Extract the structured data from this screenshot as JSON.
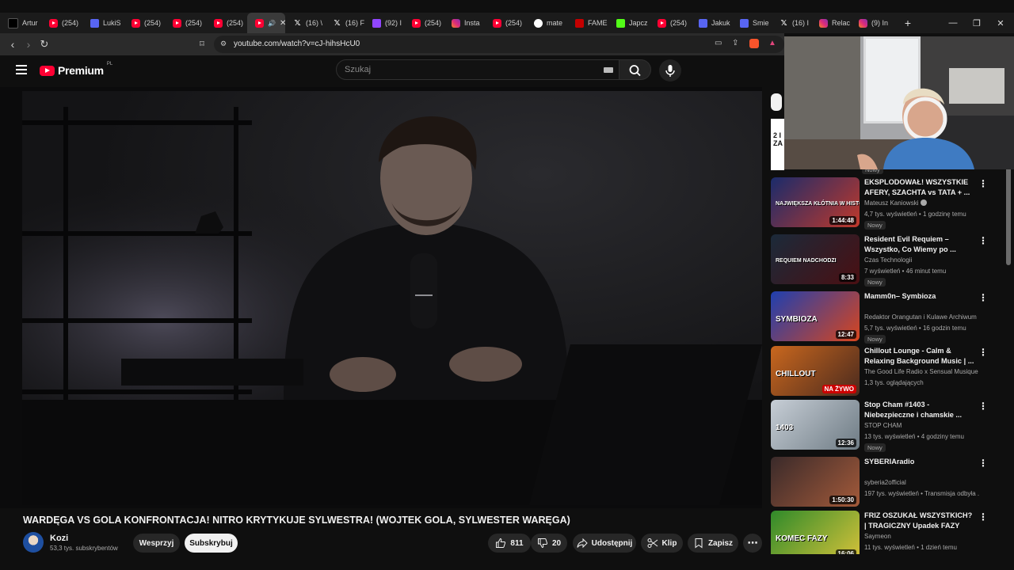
{
  "browser": {
    "tabs": [
      {
        "label": "Artur",
        "icon": "tiktok"
      },
      {
        "label": "(254)",
        "icon": "youtube"
      },
      {
        "label": "LukiS",
        "icon": "discord"
      },
      {
        "label": "(254)",
        "icon": "youtube"
      },
      {
        "label": "(254)",
        "icon": "youtube"
      },
      {
        "label": "(254)",
        "icon": "youtube"
      },
      {
        "label": "",
        "icon": "youtube-playing",
        "active": true
      },
      {
        "label": "(16) \\",
        "icon": "x"
      },
      {
        "label": "(16) F",
        "icon": "x"
      },
      {
        "label": "(92) I",
        "icon": "twitch"
      },
      {
        "label": "(254)",
        "icon": "youtube"
      },
      {
        "label": "Insta",
        "icon": "instagram"
      },
      {
        "label": "(254)",
        "icon": "youtube"
      },
      {
        "label": "mate",
        "icon": "google"
      },
      {
        "label": "FAME",
        "icon": "famemma"
      },
      {
        "label": "Japcz",
        "icon": "kick"
      },
      {
        "label": "(254)",
        "icon": "youtube"
      },
      {
        "label": "Jakuk",
        "icon": "discord"
      },
      {
        "label": "Smie",
        "icon": "discord"
      },
      {
        "label": "(16) I",
        "icon": "x"
      },
      {
        "label": "Relac",
        "icon": "instagram"
      },
      {
        "label": "(9) In",
        "icon": "instagram"
      }
    ],
    "new_tab": "+",
    "url": "youtube.com/watch?v=cJ-hihsHcU0"
  },
  "youtube": {
    "logo_text": "Premium",
    "country_code": "PL",
    "search_placeholder": "Szukaj"
  },
  "video": {
    "title": "WARDĘGA VS GOLA KONFRONTACJA! NITRO KRYTYKUJE SYLWESTRA! (WOJTEK GOLA, SYLWESTER WARĘGA)",
    "channel": "Kozi",
    "subscribers": "53,3 tys. subskrybentów",
    "join_label": "Wesprzyj",
    "subscribe_label": "Subskrybuj",
    "likes": "811",
    "dislikes": "20",
    "share_label": "Udostępnij",
    "clip_label": "Klip",
    "save_label": "Zapisz"
  },
  "sidebar": {
    "top_partial": {
      "badge": "Nowy",
      "thumb_text": "2 I ZA"
    },
    "items": [
      {
        "title": "EKSPLODOWAŁ! WSZYSTKIE AFERY, SZACHTA vs TATA + ...",
        "channel": "Mateusz Kaniowski",
        "verified": true,
        "meta": "4,7 tys. wyświetleń • 1 godzinę temu",
        "badge": "Nowy",
        "duration": "1:44:48",
        "thumb_text": "NAJWIĘKSZA KŁÓTNIA W HISTORII WWW",
        "colors": [
          "#1a2b6b",
          "#c0392b"
        ]
      },
      {
        "title": "Resident Evil Requiem – Wszystko, Co Wiemy po ...",
        "channel": "Czas Technologii",
        "verified": false,
        "meta": "7 wyświetleń • 46 minut temu",
        "badge": "Nowy",
        "duration": "8:33",
        "thumb_text": "REQUIEM NADCHODZI",
        "colors": [
          "#1b2a3a",
          "#4a0f12"
        ]
      },
      {
        "title": "Mamm0n– Symbioza",
        "channel": "Redaktor Orangutan i Kulawe Archiwum",
        "verified": false,
        "meta": "5,7 tys. wyświetleń • 16 godzin temu",
        "badge": "Nowy",
        "duration": "12:47",
        "thumb_text": "SYMBIOZA",
        "colors": [
          "#1e3fb0",
          "#d8461e"
        ]
      },
      {
        "title": "Chillout Lounge - Calm & Relaxing Background Music | ...",
        "channel": "The Good Life Radio x Sensual Musique",
        "verified": true,
        "meta": "1,3 tys. oglądających",
        "badge": "",
        "duration": "NA ŻYWO",
        "live": true,
        "thumb_text": "CHILLOUT",
        "colors": [
          "#c9671e",
          "#4a2a1e"
        ]
      },
      {
        "title": "Stop Cham #1403 - Niebezpieczne i chamskie ...",
        "channel": "STOP CHAM",
        "verified": false,
        "meta": "13 tys. wyświetleń • 4 godziny temu",
        "badge": "Nowy",
        "duration": "12:36",
        "thumb_text": "1403",
        "colors": [
          "#c7ced6",
          "#6e7b84"
        ]
      },
      {
        "title": "SYBERIAradio",
        "channel": "syberia2official",
        "verified": false,
        "meta": "197 tys. wyświetleń • Transmisja odbyła ...",
        "badge": "",
        "duration": "1:50:30",
        "thumb_text": "",
        "colors": [
          "#3a2a2a",
          "#a35a3a"
        ]
      },
      {
        "title": "FRIZ OSZUKAŁ WSZYSTKICH? | TRAGICZNY Upadek FAZY",
        "channel": "Saymeon",
        "verified": false,
        "meta": "11 tys. wyświetleń • 1 dzień temu",
        "badge": "",
        "duration": "16:06",
        "thumb_text": "KOMEC FAZY",
        "colors": [
          "#2f8a2a",
          "#d6c23a"
        ]
      }
    ]
  }
}
